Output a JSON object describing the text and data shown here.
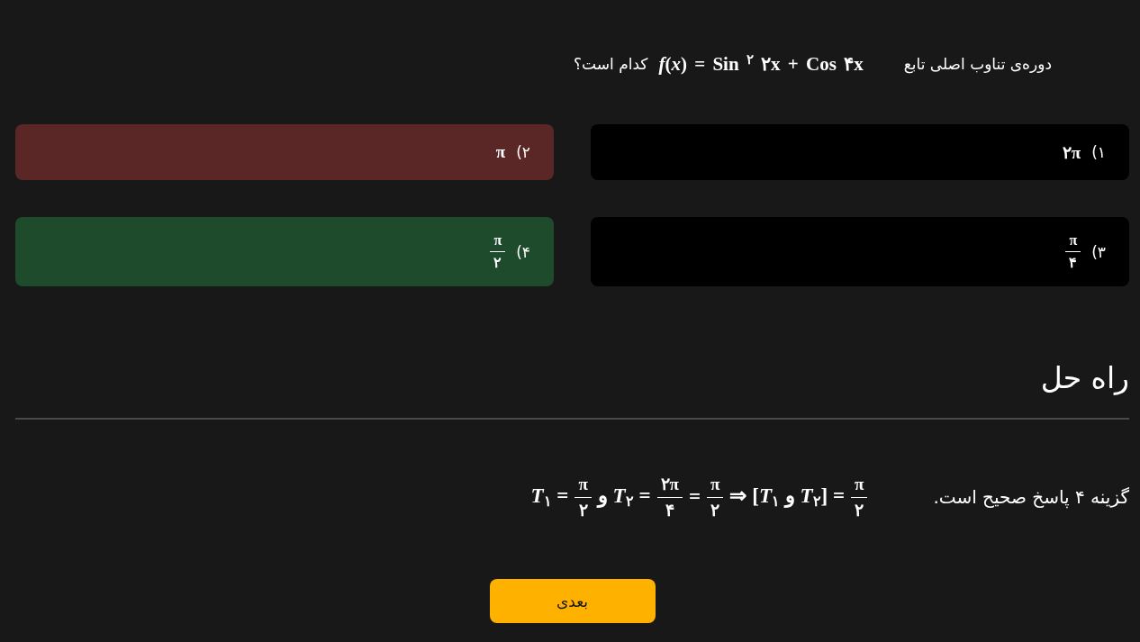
{
  "question": {
    "text_before": "دوره‌ی تناوب اصلی تابع",
    "formula": "*f*(*x*) = Sin $^{۲}$ ۲x + Cos ۴x",
    "text_after": "کدام است؟"
  },
  "options": [
    {
      "number": "۱)",
      "value": {
        "kind": "text",
        "text": "۲π"
      },
      "selected": false,
      "correct": false
    },
    {
      "number": "۲)",
      "value": {
        "kind": "text",
        "text": "π"
      },
      "selected": true,
      "correct": false
    },
    {
      "number": "۳)",
      "value": {
        "kind": "fraction",
        "numerator": "π",
        "denominator": "۴"
      },
      "selected": false,
      "correct": false
    },
    {
      "number": "۴)",
      "value": {
        "kind": "fraction",
        "numerator": "π",
        "denominator": "۲"
      },
      "selected": false,
      "correct": true
    }
  ],
  "solution": {
    "title": "راه حل",
    "text": "گزینه ۴ پاسخ صحیح است.",
    "formula": [
      {
        "kind": "fraction",
        "numerator": "π",
        "denominator": "۲"
      },
      {
        "kind": "text",
        "text": "⇒ [*T*$_{۱}$ و *T*$_{۲}$] ="
      },
      {
        "kind": "fraction",
        "numerator": "π",
        "denominator": "۲"
      },
      {
        "kind": "text",
        "text": "="
      },
      {
        "kind": "fraction",
        "numerator": "۲π",
        "denominator": "۴"
      },
      {
        "kind": "text",
        "text": "و *T*$_{۲}$ ="
      },
      {
        "kind": "fraction",
        "numerator": "π",
        "denominator": "۲"
      },
      {
        "kind": "text",
        "text": "*T*$_{۱}$ ="
      }
    ]
  },
  "next_button": {
    "label": "بعدی"
  }
}
